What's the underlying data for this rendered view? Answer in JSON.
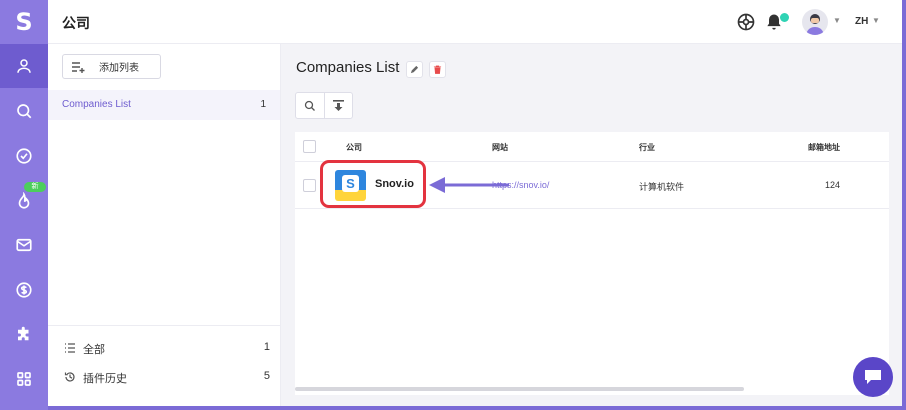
{
  "app": {
    "logo_letter": "S"
  },
  "header": {
    "title": "公司",
    "language": "ZH"
  },
  "sidebar_nav": {
    "new_badge": "新",
    "items": [
      {
        "icon": "person-icon",
        "active": true
      },
      {
        "icon": "search-icon"
      },
      {
        "icon": "check-circle-icon"
      },
      {
        "icon": "flame-icon"
      },
      {
        "icon": "mail-icon"
      },
      {
        "icon": "dollar-icon"
      },
      {
        "icon": "puzzle-icon"
      },
      {
        "icon": "grid-icon"
      }
    ]
  },
  "lists_panel": {
    "add_list_label": "添加列表",
    "lists": [
      {
        "name": "Companies List",
        "count": "1"
      }
    ],
    "footer": [
      {
        "label": "全部",
        "count": "1",
        "icon": "list-icon"
      },
      {
        "label": "插件历史",
        "count": "5",
        "icon": "history-icon"
      }
    ]
  },
  "main": {
    "heading": "Companies List",
    "table": {
      "columns": [
        "公司",
        "网站",
        "行业",
        "邮箱地址"
      ],
      "rows": [
        {
          "company": "Snov.io",
          "website": "https://snov.io/",
          "industry": "计算机软件",
          "emails": "124"
        }
      ]
    }
  },
  "colors": {
    "accent": "#7b6bd6",
    "rail": "#8b7ae0",
    "highlight": "#e3333f",
    "delete": "#e84b4b",
    "notification": "#2fd3b4"
  }
}
